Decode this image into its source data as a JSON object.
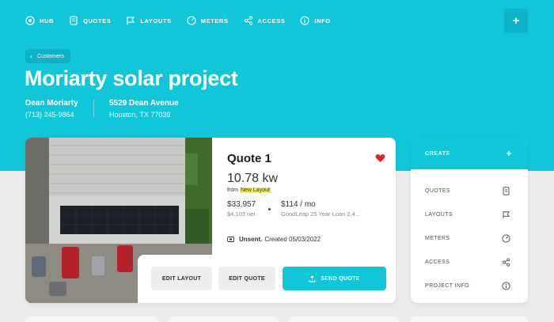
{
  "nav": {
    "items": [
      {
        "label": "HUB",
        "icon": "hub-icon"
      },
      {
        "label": "QUOTES",
        "icon": "document-icon"
      },
      {
        "label": "LAYOUTS",
        "icon": "flag-icon"
      },
      {
        "label": "METERS",
        "icon": "gauge-icon"
      },
      {
        "label": "ACCESS",
        "icon": "share-icon"
      },
      {
        "label": "INFO",
        "icon": "info-icon"
      }
    ],
    "add_label": "+"
  },
  "breadcrumb": {
    "label": "Customers"
  },
  "project": {
    "title": "Moriarty solar project",
    "customer_name": "Dean Moriarty",
    "phone": "(713) 245-9864",
    "address_line1": "5529 Dean Avenue",
    "address_line2": "Houston, TX 77039"
  },
  "quote": {
    "title": "Quote 1",
    "size": "10.78 kw",
    "from_prefix": "from",
    "layout_link": "New Layout",
    "price": "$33,957",
    "net": "$4,103 net",
    "monthly": "$114 / mo",
    "loan": "GoodLeap 25 Year Loan 2.4...",
    "status": "Unsent.",
    "created": "Created 05/03/2022",
    "favorite": true,
    "buttons": {
      "edit_layout": "EDIT LAYOUT",
      "edit_quote": "EDIT QUOTE",
      "send_quote": "SEND QUOTE"
    }
  },
  "side": {
    "header": "CREATE",
    "header_action": "+",
    "items": [
      {
        "label": "QUOTES",
        "icon": "document-icon"
      },
      {
        "label": "LAYOUTS",
        "icon": "flag-icon"
      },
      {
        "label": "METERS",
        "icon": "gauge-icon"
      },
      {
        "label": "ACCESS",
        "icon": "share-icon"
      },
      {
        "label": "PROJECT INFO",
        "icon": "info-icon"
      }
    ]
  },
  "colors": {
    "accent": "#12c6da",
    "heart": "#e8202a",
    "highlight": "#f4f24a"
  }
}
